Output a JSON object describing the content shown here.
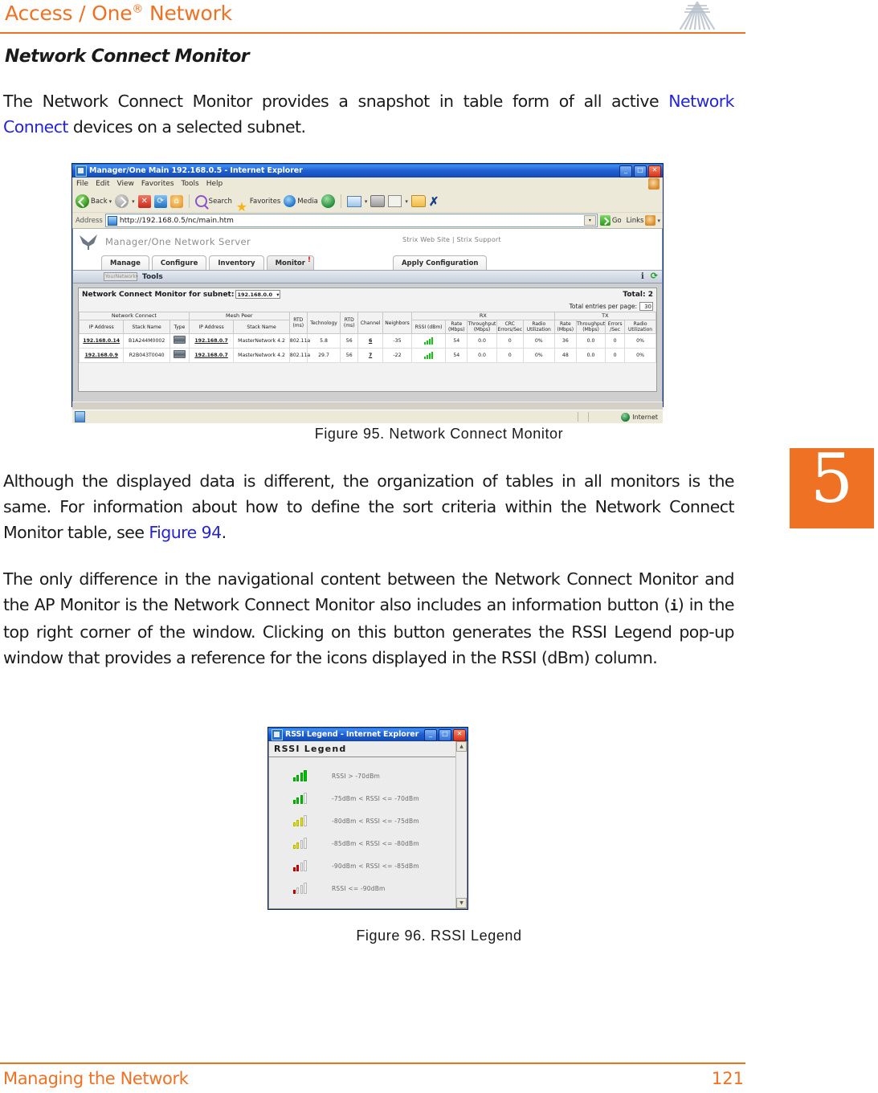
{
  "header": {
    "title_main": "Access / One",
    "title_sup": "®",
    "title_tail": " Network",
    "logo_icon": "strix-fan-logo",
    "accent_color": "#ef7123"
  },
  "section": {
    "title": "Network Connect Monitor",
    "paragraph_1_a": "The Network Connect Monitor provides a snapshot in table form of all active ",
    "paragraph_1_link": "Network Connect",
    "paragraph_1_b": " devices on a selected subnet.",
    "paragraph_2_a": "Although the displayed data is different, the organization of tables in all monitors is the same. For information about how to define the sort criteria within the Network Connect Monitor table, see ",
    "paragraph_2_link": "Figure 94",
    "paragraph_2_b": ".",
    "paragraph_3_a": "The only difference in the navigational content between the Network Connect Monitor and the AP Monitor is the Network Connect Monitor also includes an information button (",
    "paragraph_3_icon": "i",
    "paragraph_3_b": ") in the top right corner of the window. Clicking on this button generates the RSSI Legend pop-up window that provides a reference for the icons displayed in the RSSI (dBm) column."
  },
  "figure_95": {
    "caption": "Figure 95. Network Connect Monitor",
    "browser": {
      "title": "Manager/One Main 192.168.0.5 - Internet Explorer",
      "window_buttons": {
        "minimize": "_",
        "maximize": "□",
        "close": "✕"
      },
      "menus": [
        "File",
        "Edit",
        "View",
        "Favorites",
        "Tools",
        "Help"
      ],
      "toolbar": {
        "back_label": "Back",
        "search_label": "Search",
        "favorites_label": "Favorites",
        "media_label": "Media"
      },
      "address": {
        "label": "Address",
        "url": "http://192.168.0.5/nc/main.htm",
        "go_label": "Go",
        "links_label": "Links"
      },
      "status": {
        "zone": "Internet"
      }
    },
    "app": {
      "brand": "Manager/One Network Server",
      "links": "Strix Web Site   |   Strix Support",
      "tabs": [
        {
          "label": "Manage",
          "active": false,
          "badge": ""
        },
        {
          "label": "Configure",
          "active": false,
          "badge": ""
        },
        {
          "label": "Inventory",
          "active": false,
          "badge": ""
        },
        {
          "label": "Monitor",
          "active": true,
          "badge": "!"
        }
      ],
      "apply_tab": "Apply Configuration",
      "toolbar": {
        "network_select": "YourNetwork",
        "tools_label": "Tools",
        "info_icon": "i",
        "refresh_icon": "⟳"
      },
      "panel": {
        "heading": "Network Connect Monitor for subnet:",
        "subnet_value": "192.168.0.0",
        "total_label": "Total: 2",
        "entries_label": "Total entries per page:",
        "entries_value": "30"
      },
      "table": {
        "group_headers": [
          {
            "label": "Network Connect",
            "span": 3
          },
          {
            "label": "Mesh Peer",
            "span": 2
          },
          {
            "label": "",
            "span": 1
          },
          {
            "label": "",
            "span": 1
          },
          {
            "label": "",
            "span": 1
          },
          {
            "label": "",
            "span": 1
          },
          {
            "label": "",
            "span": 1
          },
          {
            "label": "RX",
            "span": 5
          },
          {
            "label": "TX",
            "span": 4
          }
        ],
        "columns": [
          "IP Address",
          "Stack Name",
          "Type",
          "IP Address",
          "Stack Name",
          "RTD (ms)",
          "Technology",
          "RTD (ms)",
          "Channel",
          "Neighbors",
          "RSSI (dBm)",
          "Rate (Mbps)",
          "Throughput (Mbps)",
          "CRC Errors/Sec",
          "Radio Utilization",
          "Rate (Mbps)",
          "Throughput (Mbps)",
          "Errors /Sec",
          "Radio Utilization"
        ],
        "rows": [
          {
            "nc_ip": "192.168.0.14",
            "nc_stack": "B1A244M0002",
            "type_icon": "device-icon",
            "peer_ip": "192.168.0.7",
            "peer_stack": "MasterNetwork 4.2",
            "rtd1": "",
            "technology": "802.11a",
            "rtd2": "5.8",
            "channel": "56",
            "neighbors": "6",
            "rssi": "-35",
            "rssi_icon": "signal-bars-4-green",
            "rx_rate": "54",
            "rx_throughput": "0.0",
            "rx_crc": "0",
            "rx_util": "0%",
            "tx_rate": "36",
            "tx_throughput": "0.0",
            "tx_errors": "0",
            "tx_util": "0%"
          },
          {
            "nc_ip": "192.168.0.9",
            "nc_stack": "R2B043T0040",
            "type_icon": "device-icon",
            "peer_ip": "192.168.0.7",
            "peer_stack": "MasterNetwork 4.2",
            "rtd1": "",
            "technology": "802.11a",
            "rtd2": "29.7",
            "channel": "56",
            "neighbors": "7",
            "rssi": "-22",
            "rssi_icon": "signal-bars-4-green",
            "rx_rate": "54",
            "rx_throughput": "0.0",
            "rx_crc": "0",
            "rx_util": "0%",
            "tx_rate": "48",
            "tx_throughput": "0.0",
            "tx_errors": "0",
            "tx_util": "0%"
          }
        ]
      }
    }
  },
  "figure_96": {
    "caption": "Figure 96. RSSI Legend",
    "window": {
      "title": "RSSI Legend - Internet Explorer",
      "window_buttons": {
        "minimize": "_",
        "maximize": "□",
        "close": "✕"
      },
      "heading": "RSSI Legend",
      "legend": [
        {
          "icon": "signal-bars-4-green",
          "bars": [
            "on-g",
            "on-g",
            "on-g",
            "on-g"
          ],
          "text": "RSSI > -70dBm"
        },
        {
          "icon": "signal-bars-3-green",
          "bars": [
            "on-g",
            "on-g",
            "on-g",
            "off"
          ],
          "text": "-75dBm < RSSI <= -70dBm"
        },
        {
          "icon": "signal-bars-3-yellow",
          "bars": [
            "on-y",
            "on-y",
            "on-y",
            "off"
          ],
          "text": "-80dBm < RSSI <= -75dBm"
        },
        {
          "icon": "signal-bars-2-yellow",
          "bars": [
            "on-y",
            "on-y",
            "off",
            "off"
          ],
          "text": "-85dBm < RSSI <= -80dBm"
        },
        {
          "icon": "signal-bars-2-red",
          "bars": [
            "on-r",
            "on-r",
            "off",
            "off"
          ],
          "text": "-90dBm < RSSI <= -85dBm"
        },
        {
          "icon": "signal-bars-1-red",
          "bars": [
            "on-r",
            "off",
            "off",
            "off"
          ],
          "text": "RSSI <= -90dBm"
        }
      ]
    }
  },
  "chapter_tab": {
    "number": "5"
  },
  "footer": {
    "left": "Managing the Network",
    "page": "121"
  }
}
